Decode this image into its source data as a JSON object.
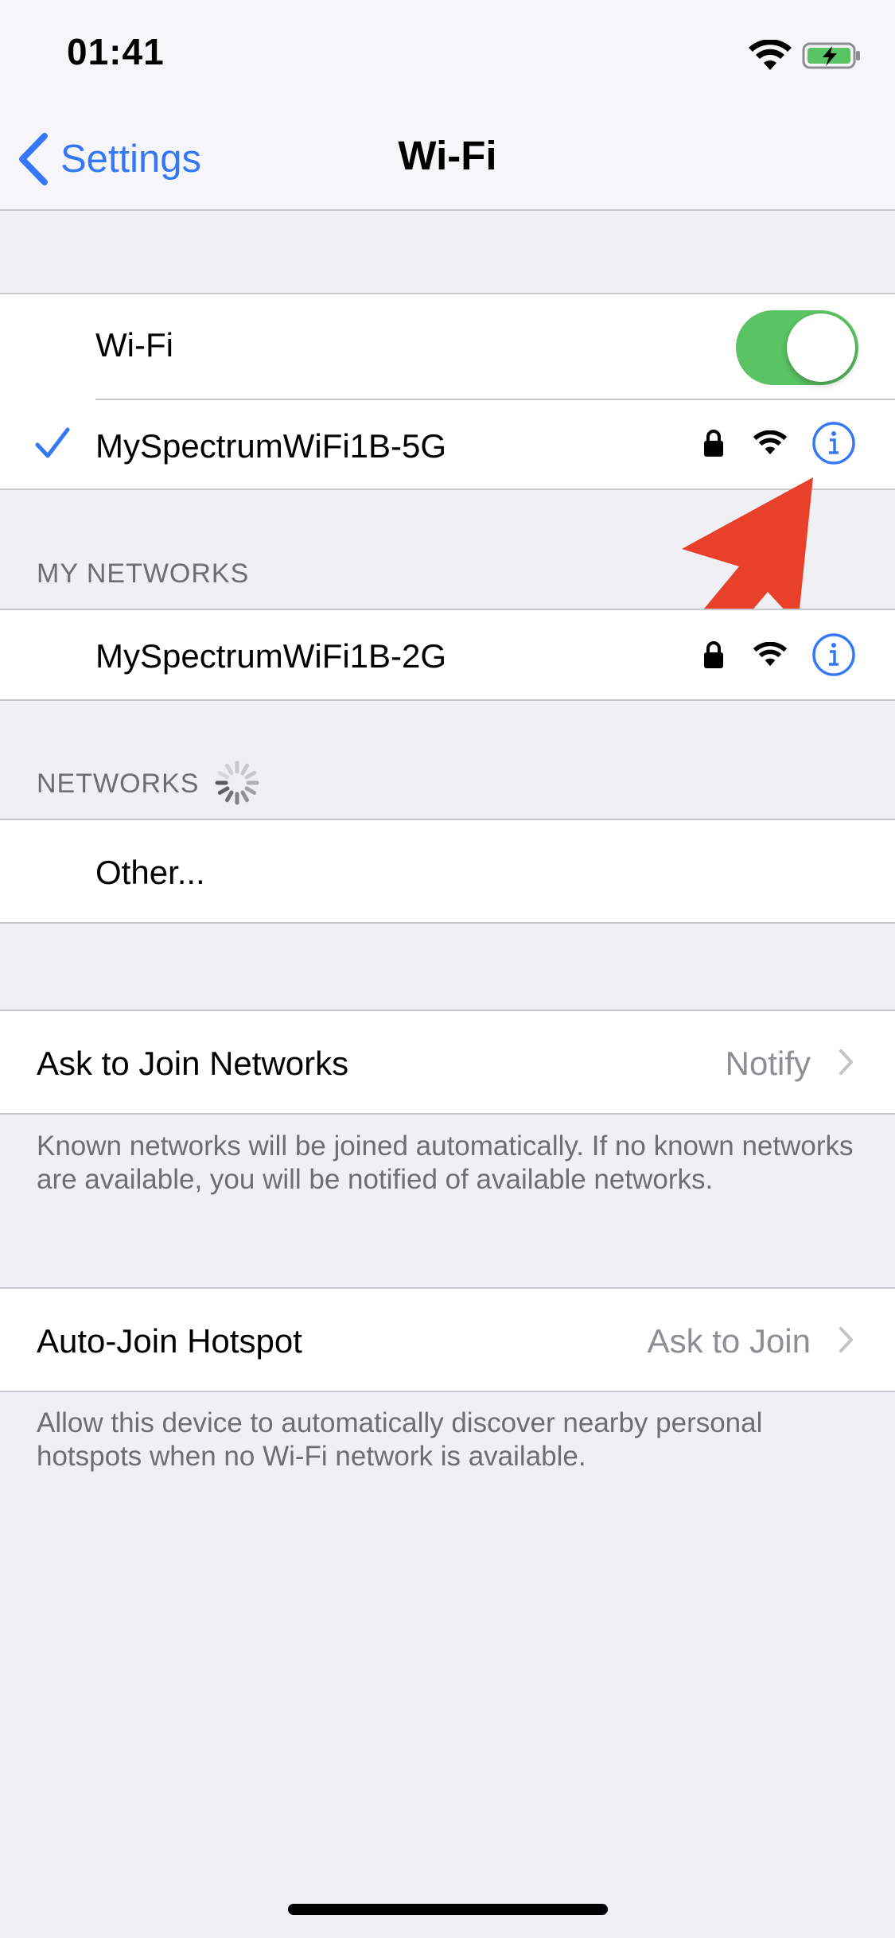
{
  "status_bar": {
    "time": "01:41"
  },
  "nav": {
    "back_label": "Settings",
    "title": "Wi-Fi"
  },
  "wifi_group": {
    "toggle_label": "Wi-Fi",
    "toggle_on": true,
    "connected_network": "MySpectrumWiFi1B-5G"
  },
  "my_networks": {
    "header": "MY NETWORKS",
    "items": [
      {
        "name": "MySpectrumWiFi1B-2G"
      }
    ]
  },
  "networks": {
    "header": "NETWORKS",
    "other_label": "Other..."
  },
  "ask_to_join": {
    "label": "Ask to Join Networks",
    "value": "Notify",
    "footer": "Known networks will be joined automatically. If no known networks are available, you will be notified of available networks."
  },
  "auto_join_hotspot": {
    "label": "Auto-Join Hotspot",
    "value": "Ask to Join",
    "footer": "Allow this device to automatically discover nearby personal hotspots when no Wi-Fi network is available."
  },
  "colors": {
    "accent": "#3478f6",
    "toggle_on": "#5ac363",
    "annotation_arrow": "#e8402a",
    "background": "#efeff4"
  }
}
